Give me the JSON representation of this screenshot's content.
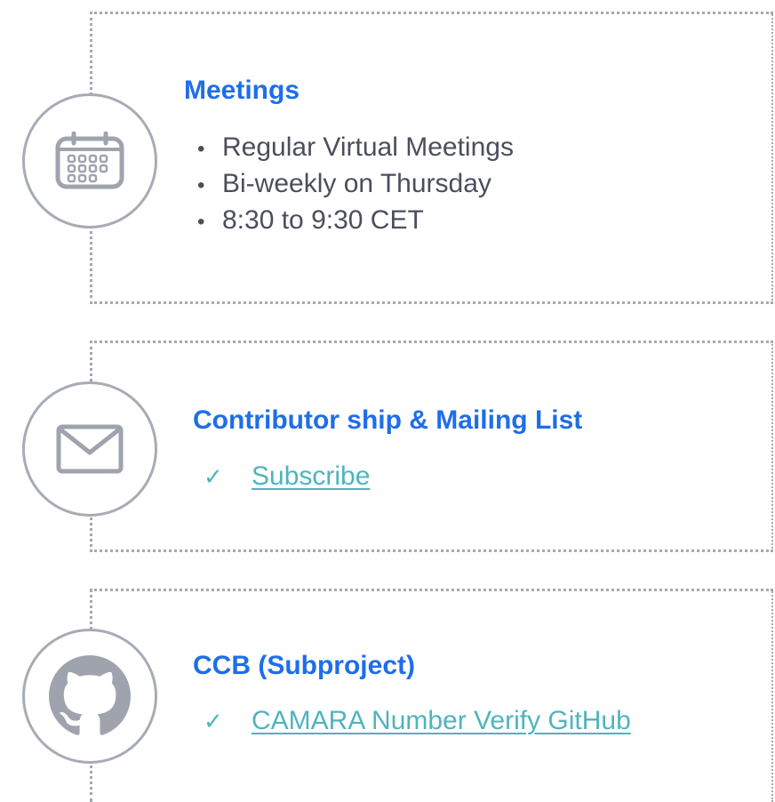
{
  "colors": {
    "title": "#1e6ee8",
    "body_text": "#4b4f5c",
    "link": "#4fb4bd",
    "icon": "#9fa3ad",
    "border": "#a3a8b4"
  },
  "sections": [
    {
      "icon": "calendar-icon",
      "title": "Meetings",
      "items": [
        "Regular Virtual Meetings",
        "Bi-weekly on Thursday",
        "8:30 to 9:30 CET"
      ],
      "bullet": "•"
    },
    {
      "icon": "envelope-icon",
      "title": "Contributor ship & Mailing List",
      "links": [
        {
          "check": "✓",
          "label": "Subscribe"
        }
      ]
    },
    {
      "icon": "github-icon",
      "title": "CCB (Subproject)",
      "links": [
        {
          "check": "✓",
          "label": "CAMARA Number Verify GitHub"
        }
      ]
    }
  ]
}
